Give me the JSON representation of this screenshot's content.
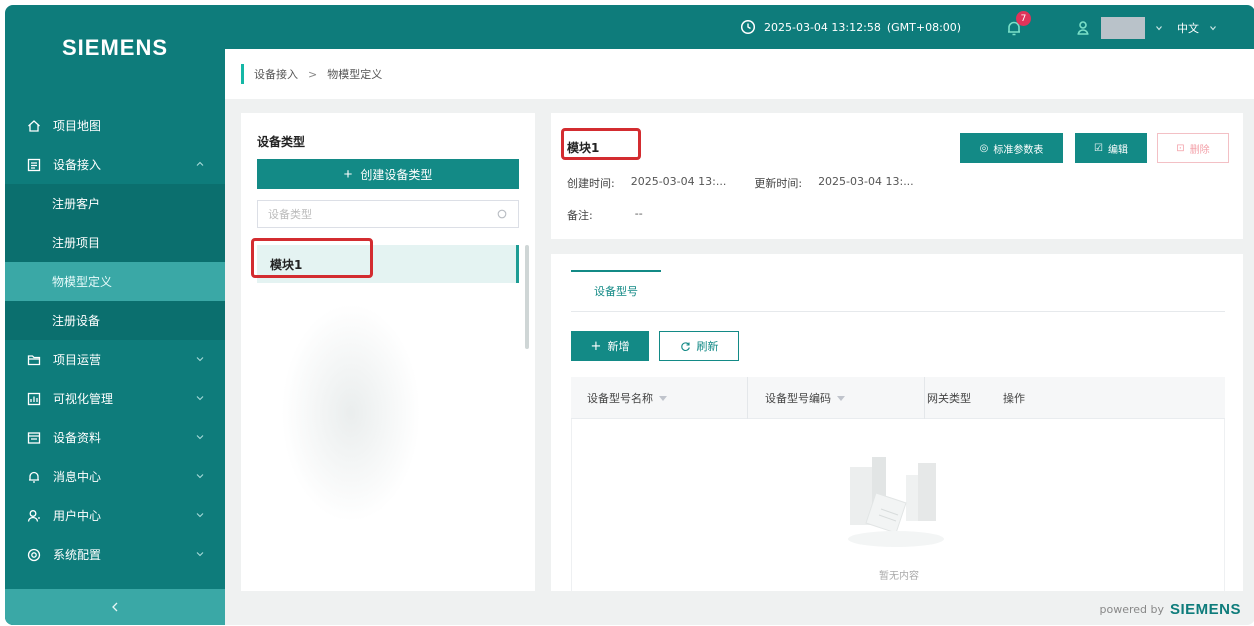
{
  "brand": {
    "logo": "SIEMENS",
    "powered_by": "powered by",
    "powered_brand": "SIEMENS"
  },
  "topbar": {
    "datetime": "2025-03-04 13:12:58",
    "timezone": "(GMT+08:00)",
    "notification_count": "7",
    "language": "中文"
  },
  "sidebar": {
    "items": [
      {
        "label": "项目地图",
        "icon": "home-icon"
      },
      {
        "label": "设备接入",
        "icon": "device-access-icon"
      },
      {
        "label": "项目运营",
        "icon": "folder-icon"
      },
      {
        "label": "可视化管理",
        "icon": "chart-icon"
      },
      {
        "label": "设备资料",
        "icon": "document-icon"
      },
      {
        "label": "消息中心",
        "icon": "bell-icon"
      },
      {
        "label": "用户中心",
        "icon": "user-icon"
      },
      {
        "label": "系统配置",
        "icon": "settings-icon"
      }
    ],
    "sub_items": [
      "注册客户",
      "注册项目",
      "物模型定义",
      "注册设备"
    ],
    "active_sub": "物模型定义"
  },
  "breadcrumb": [
    "设备接入",
    "物模型定义"
  ],
  "left_panel": {
    "title": "设备类型",
    "create_button": "创建设备类型",
    "search_placeholder": "设备类型",
    "items": [
      "模块1"
    ]
  },
  "info": {
    "name": "模块1",
    "created_label": "创建时间:",
    "created_value": "2025-03-04 13:...",
    "updated_label": "更新时间:",
    "updated_value": "2025-03-04 13:...",
    "note_label": "备注:",
    "note_value": "--",
    "buttons": {
      "std_params": "标准参数表",
      "edit": "编辑",
      "delete": "删除"
    }
  },
  "models": {
    "tab": "设备型号",
    "add_button": "新增",
    "refresh_button": "刷新",
    "columns": [
      "设备型号名称",
      "设备型号编码",
      "网关类型",
      "操作"
    ],
    "rows": [],
    "empty_text": "暂无内容"
  },
  "colors": {
    "primary": "#0e7c7b",
    "accent": "#138a86",
    "highlight": "#d32c30",
    "badge": "#e0335a"
  }
}
